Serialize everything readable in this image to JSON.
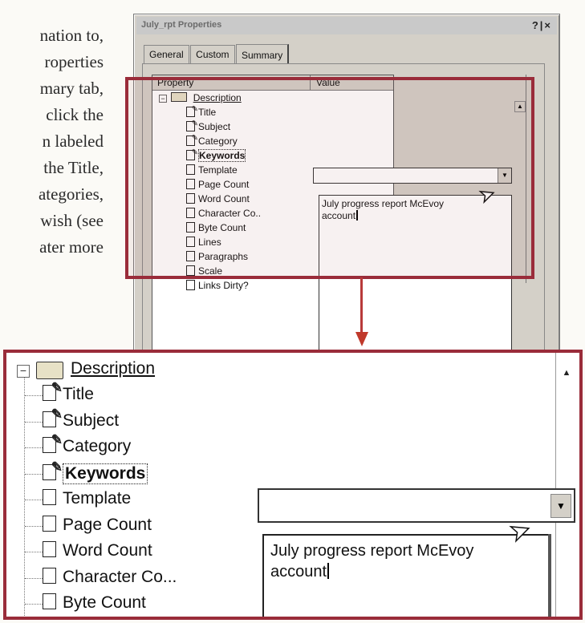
{
  "book_text": {
    "lines": [
      "nation to,",
      "roperties",
      "mary tab,",
      "click the",
      "n labeled",
      "the Title,",
      "ategories,",
      "wish (see",
      "ater more"
    ]
  },
  "dialog": {
    "title": "July_rpt Properties",
    "help_close": "?|×",
    "tabs": [
      "General",
      "Custom",
      "Summary"
    ],
    "active_tab": "Summary",
    "columns": {
      "property": "Property",
      "value": "Value"
    }
  },
  "properties": {
    "group": "Description",
    "items": [
      {
        "label": "Title",
        "icon": "edit-doc-icon"
      },
      {
        "label": "Subject",
        "icon": "edit-doc-icon"
      },
      {
        "label": "Category",
        "icon": "edit-doc-icon"
      },
      {
        "label": "Keywords",
        "icon": "edit-doc-icon"
      },
      {
        "label": "Template",
        "icon": "doc-icon"
      },
      {
        "label": "Page Count",
        "icon": "doc-icon"
      },
      {
        "label": "Word Count",
        "icon": "doc-icon"
      },
      {
        "label": "Character Co...",
        "icon": "doc-icon"
      },
      {
        "label": "Byte Count",
        "icon": "doc-icon"
      },
      {
        "label": "Lines",
        "icon": "doc-icon"
      },
      {
        "label": "Paragraphs",
        "icon": "doc-icon"
      },
      {
        "label": "Scale",
        "icon": "doc-icon"
      },
      {
        "label": "Links Dirty?",
        "icon": "doc-icon"
      }
    ]
  },
  "small_labels": {
    "character": "Character Co..",
    "byte": "Byte Count"
  },
  "zoom": {
    "group": "Description",
    "items": [
      "Title",
      "Subject",
      "Category",
      "Keywords",
      "Template",
      "Page Count",
      "Word Count",
      "Character Co...",
      "Byte Count"
    ]
  },
  "value_edit": {
    "combo_value": "",
    "text_line1": "July progress report McEvoy",
    "text_line2": "account"
  },
  "colors": {
    "highlight_red": "#9a2c3a",
    "arrow_red": "#c0392b",
    "dialog_gray": "#d4d0c8"
  }
}
